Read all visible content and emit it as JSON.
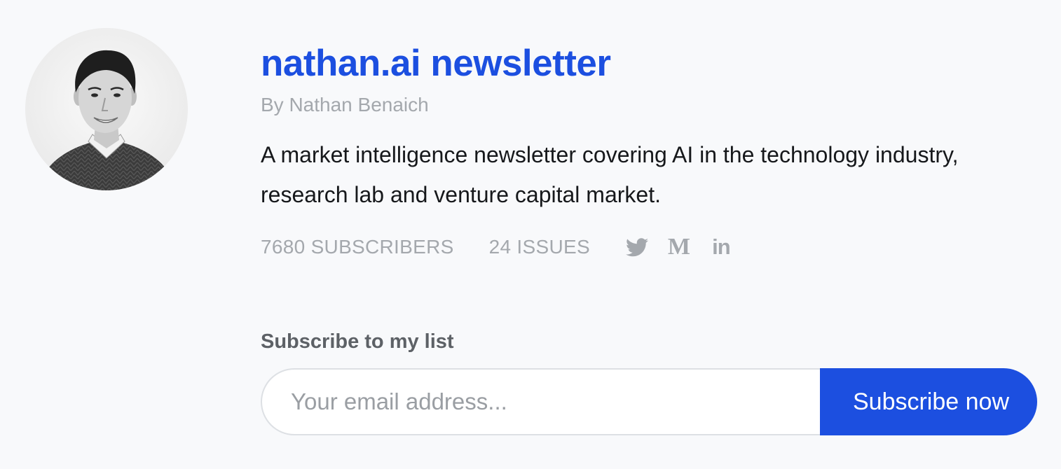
{
  "profile": {
    "avatar_alt": "Nathan Benaich"
  },
  "newsletter": {
    "title": "nathan.ai newsletter",
    "byline": "By Nathan Benaich",
    "description": "A market intelligence newsletter covering AI in the technology industry, research lab and venture capital market."
  },
  "stats": {
    "subscribers": "7680 SUBSCRIBERS",
    "issues": "24 ISSUES"
  },
  "socials": {
    "twitter_icon": "twitter-icon",
    "medium_icon": "medium-icon",
    "medium_glyph": "M",
    "linkedin_icon": "linkedin-icon",
    "linkedin_glyph": "in"
  },
  "subscribe": {
    "label": "Subscribe to my list",
    "email_placeholder": "Your email address...",
    "email_value": "",
    "button_label": "Subscribe now"
  },
  "colors": {
    "accent": "#1c4fe0",
    "background": "#f8f9fb",
    "muted_text": "#a4a8ad",
    "body_text": "#16181b"
  }
}
